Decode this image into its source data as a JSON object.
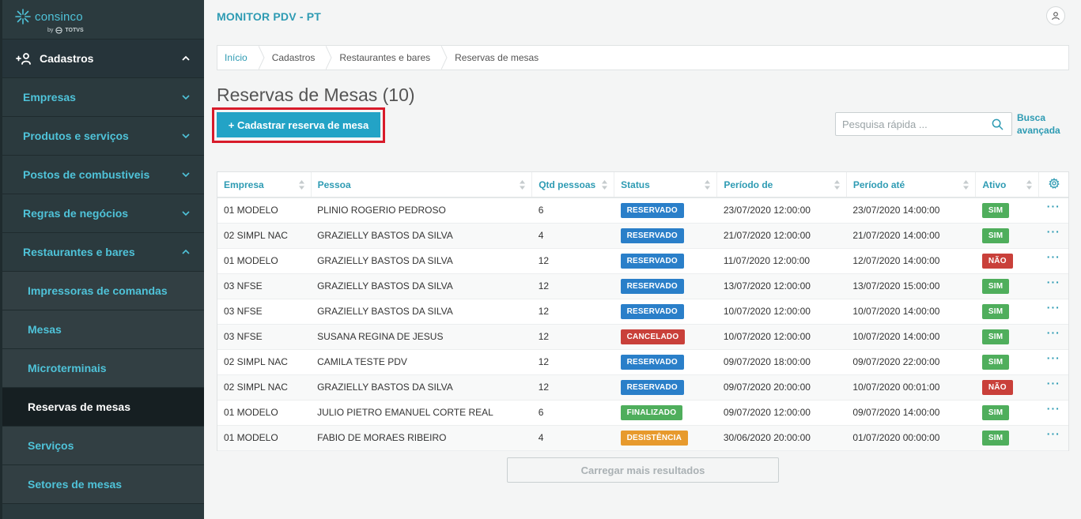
{
  "brand": {
    "name": "consinco",
    "by": "by",
    "totvs": "TOTVS"
  },
  "sidebar": {
    "section": "Cadastros",
    "items": [
      {
        "label": "Empresas",
        "expanded": false
      },
      {
        "label": "Produtos e serviços",
        "expanded": false
      },
      {
        "label": "Postos de combustiveis",
        "expanded": false
      },
      {
        "label": "Regras de negócios",
        "expanded": false
      },
      {
        "label": "Restaurantes e bares",
        "expanded": true
      }
    ],
    "subitems": [
      {
        "label": "Impressoras de comandas"
      },
      {
        "label": "Mesas"
      },
      {
        "label": "Microterminais"
      },
      {
        "label": "Reservas de mesas",
        "active": true
      },
      {
        "label": "Serviços"
      },
      {
        "label": "Setores de mesas"
      }
    ]
  },
  "header": {
    "app_title": "MONITOR PDV - PT"
  },
  "breadcrumb": [
    "Início",
    "Cadastros",
    "Restaurantes e bares",
    "Reservas de mesas"
  ],
  "page": {
    "title": "Reservas de Mesas (10)",
    "cta_label": "+ Cadastrar reserva de mesa",
    "search_placeholder": "Pesquisa rápida ...",
    "advanced_line1": "Busca",
    "advanced_line2": "avançada",
    "load_more": "Carregar mais resultados"
  },
  "table": {
    "columns": [
      "Empresa",
      "Pessoa",
      "Qtd pessoas",
      "Status",
      "Período de",
      "Período até",
      "Ativo"
    ],
    "rows": [
      {
        "empresa": "01 MODELO",
        "pessoa": "PLINIO ROGERIO PEDROSO",
        "qtd": "6",
        "status": "RESERVADO",
        "de": "23/07/2020 12:00:00",
        "ate": "23/07/2020 14:00:00",
        "ativo": "SIM"
      },
      {
        "empresa": "02 SIMPL NAC",
        "pessoa": "GRAZIELLY BASTOS DA SILVA",
        "qtd": "4",
        "status": "RESERVADO",
        "de": "21/07/2020 12:00:00",
        "ate": "21/07/2020 14:00:00",
        "ativo": "SIM"
      },
      {
        "empresa": "01 MODELO",
        "pessoa": "GRAZIELLY BASTOS DA SILVA",
        "qtd": "12",
        "status": "RESERVADO",
        "de": "11/07/2020 12:00:00",
        "ate": "12/07/2020 14:00:00",
        "ativo": "NÃO"
      },
      {
        "empresa": "03 NFSE",
        "pessoa": "GRAZIELLY BASTOS DA SILVA",
        "qtd": "12",
        "status": "RESERVADO",
        "de": "13/07/2020 12:00:00",
        "ate": "13/07/2020 15:00:00",
        "ativo": "SIM"
      },
      {
        "empresa": "03 NFSE",
        "pessoa": "GRAZIELLY BASTOS DA SILVA",
        "qtd": "12",
        "status": "RESERVADO",
        "de": "10/07/2020 12:00:00",
        "ate": "10/07/2020 14:00:00",
        "ativo": "SIM"
      },
      {
        "empresa": "03 NFSE",
        "pessoa": "SUSANA REGINA DE JESUS",
        "qtd": "12",
        "status": "CANCELADO",
        "de": "10/07/2020 12:00:00",
        "ate": "10/07/2020 14:00:00",
        "ativo": "SIM"
      },
      {
        "empresa": "02 SIMPL NAC",
        "pessoa": "CAMILA TESTE PDV",
        "qtd": "12",
        "status": "RESERVADO",
        "de": "09/07/2020 18:00:00",
        "ate": "09/07/2020 22:00:00",
        "ativo": "SIM"
      },
      {
        "empresa": "02 SIMPL NAC",
        "pessoa": "GRAZIELLY BASTOS DA SILVA",
        "qtd": "12",
        "status": "RESERVADO",
        "de": "09/07/2020 20:00:00",
        "ate": "10/07/2020 00:01:00",
        "ativo": "NÃO"
      },
      {
        "empresa": "01 MODELO",
        "pessoa": "JULIO PIETRO EMANUEL CORTE REAL",
        "qtd": "6",
        "status": "FINALIZADO",
        "de": "09/07/2020 12:00:00",
        "ate": "09/07/2020 14:00:00",
        "ativo": "SIM"
      },
      {
        "empresa": "01 MODELO",
        "pessoa": "FABIO DE MORAES RIBEIRO",
        "qtd": "4",
        "status": "DESISTÊNCIA",
        "de": "30/06/2020 20:00:00",
        "ate": "01/07/2020 00:00:00",
        "ativo": "SIM"
      }
    ],
    "row_action": "···"
  },
  "colors": {
    "accent": "#2e9bb3",
    "sidebar_bg": "#2b3a3e",
    "RESERVADO": "#2a7fc9",
    "CANCELADO": "#c9403a",
    "FINALIZADO": "#4fae5c",
    "DESISTÊNCIA": "#e79a2d",
    "SIM": "#4fae5c",
    "NÃO": "#c9403a",
    "highlight_box": "#d81b2a"
  },
  "icons": {
    "user": "user-icon",
    "search": "search-icon",
    "gear": "gear-icon",
    "chevron": "chevron-icon",
    "sort": "sort-icon",
    "add_user": "add-user-icon",
    "logo": "logo-icon"
  }
}
